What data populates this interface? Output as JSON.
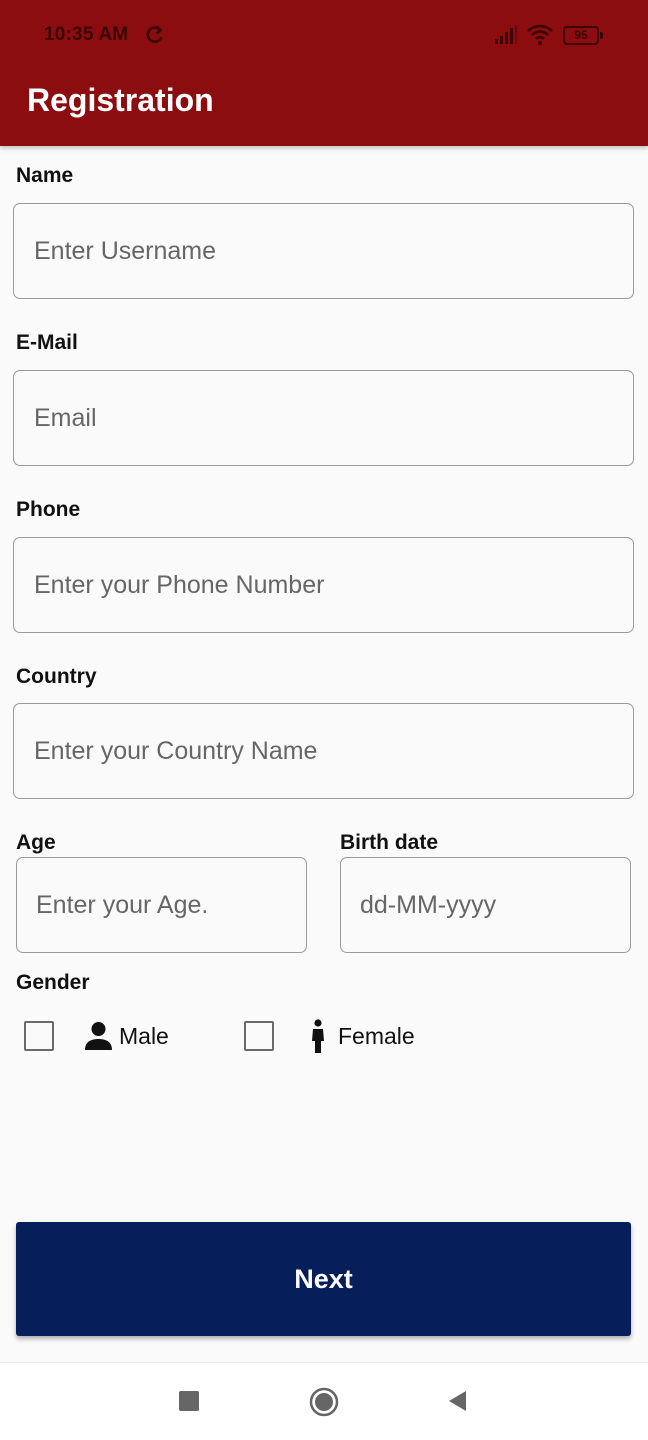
{
  "status_bar": {
    "time": "10:35 AM",
    "battery": "95"
  },
  "app_bar": {
    "title": "Registration"
  },
  "form": {
    "name": {
      "label": "Name",
      "placeholder": "Enter Username"
    },
    "email": {
      "label": "E-Mail",
      "placeholder": "Email"
    },
    "phone": {
      "label": "Phone",
      "placeholder": "Enter your Phone Number"
    },
    "country": {
      "label": "Country",
      "placeholder": "Enter your Country Name"
    },
    "age": {
      "label": "Age",
      "placeholder": "Enter your Age."
    },
    "birth_date": {
      "label": "Birth date",
      "placeholder": "dd-MM-yyyy"
    },
    "gender": {
      "label": "Gender",
      "options": [
        {
          "label": "Male",
          "icon": "person-icon",
          "checked": false
        },
        {
          "label": "Female",
          "icon": "woman-icon",
          "checked": false
        }
      ]
    },
    "next_label": "Next"
  },
  "colors": {
    "app_bar": "#8c0d10",
    "button": "#061e5a",
    "background": "#fafafa"
  },
  "nav_bar": {
    "icons": [
      "recent-apps-icon",
      "home-icon",
      "back-icon"
    ]
  }
}
